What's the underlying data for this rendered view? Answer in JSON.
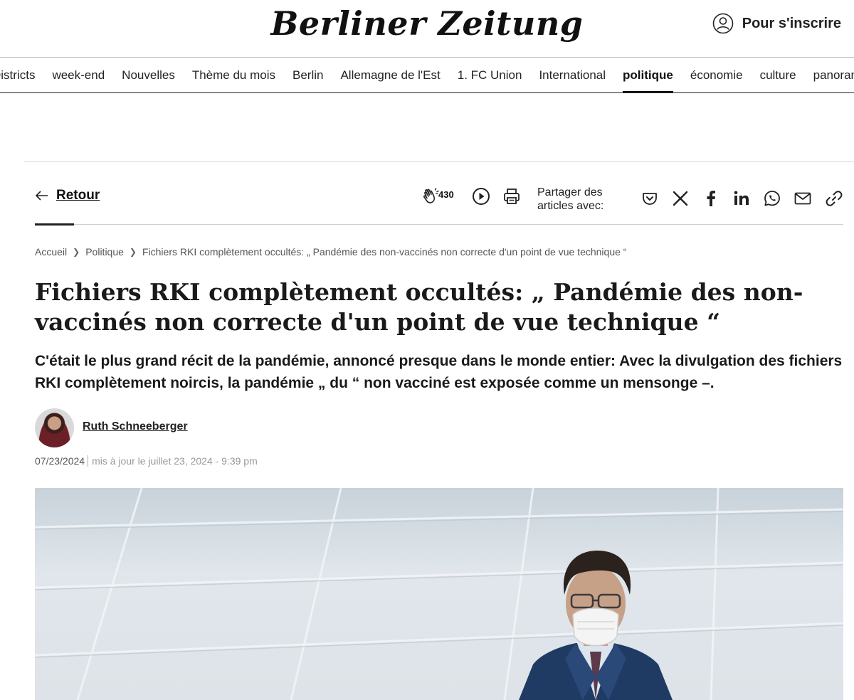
{
  "header": {
    "logo_text": "Berliner Zeitung",
    "login_label": "Pour s'inscrire"
  },
  "nav": {
    "items": [
      {
        "label": "Districts",
        "active": false
      },
      {
        "label": "week-end",
        "active": false
      },
      {
        "label": "Nouvelles",
        "active": false
      },
      {
        "label": "Thème du mois",
        "active": false
      },
      {
        "label": "Berlin",
        "active": false
      },
      {
        "label": "Allemagne de l'Est",
        "active": false
      },
      {
        "label": "1. FC Union",
        "active": false
      },
      {
        "label": "International",
        "active": false
      },
      {
        "label": "politique",
        "active": true
      },
      {
        "label": "économie",
        "active": false
      },
      {
        "label": "culture",
        "active": false
      },
      {
        "label": "panorama",
        "active": false
      }
    ]
  },
  "toolbar": {
    "back_label": "Retour",
    "clap_count": "430",
    "share_label": "Partager des articles avec:",
    "share_icons": [
      "pocket-icon",
      "x-icon",
      "facebook-icon",
      "linkedin-icon",
      "whatsapp-icon",
      "email-icon",
      "link-icon"
    ]
  },
  "breadcrumb": {
    "items": [
      "Accueil",
      "Politique",
      "Fichiers RKI complètement occultés: „ Pandémie des non-vaccinés non correcte d'un point de vue technique “"
    ]
  },
  "article": {
    "title": "Fichiers RKI complètement occultés: „ Pandémie des non-vaccinés non correcte d'un point de vue technique “",
    "lead": "C'était le plus grand récit de la pandémie, annoncé presque dans le monde entier: Avec la divulgation des fichiers RKI complètement noircis, la pandémie „ du “ non vacciné est exposée comme un mensonge –.",
    "author": "Ruth Schneeberger",
    "date": "07/23/2024",
    "updated": "mis à jour le juillet 23, 2024 - 9:39 pm"
  },
  "colors": {
    "text": "#111111",
    "rule": "#d6d6d6",
    "suit": "#1f3a63",
    "image_bg": "#e2e8ed"
  }
}
